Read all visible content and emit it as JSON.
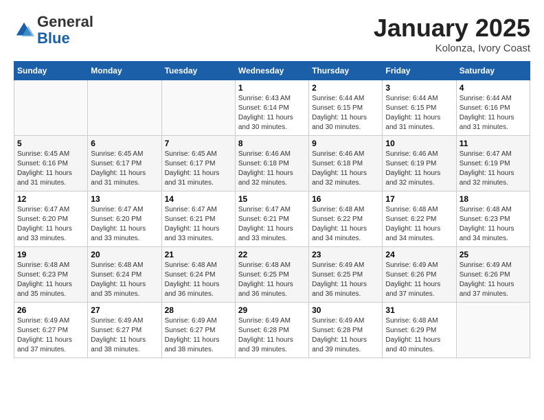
{
  "header": {
    "logo_general": "General",
    "logo_blue": "Blue",
    "month": "January 2025",
    "location": "Kolonza, Ivory Coast"
  },
  "weekdays": [
    "Sunday",
    "Monday",
    "Tuesday",
    "Wednesday",
    "Thursday",
    "Friday",
    "Saturday"
  ],
  "weeks": [
    [
      {
        "day": "",
        "info": ""
      },
      {
        "day": "",
        "info": ""
      },
      {
        "day": "",
        "info": ""
      },
      {
        "day": "1",
        "info": "Sunrise: 6:43 AM\nSunset: 6:14 PM\nDaylight: 11 hours\nand 30 minutes."
      },
      {
        "day": "2",
        "info": "Sunrise: 6:44 AM\nSunset: 6:15 PM\nDaylight: 11 hours\nand 30 minutes."
      },
      {
        "day": "3",
        "info": "Sunrise: 6:44 AM\nSunset: 6:15 PM\nDaylight: 11 hours\nand 31 minutes."
      },
      {
        "day": "4",
        "info": "Sunrise: 6:44 AM\nSunset: 6:16 PM\nDaylight: 11 hours\nand 31 minutes."
      }
    ],
    [
      {
        "day": "5",
        "info": "Sunrise: 6:45 AM\nSunset: 6:16 PM\nDaylight: 11 hours\nand 31 minutes."
      },
      {
        "day": "6",
        "info": "Sunrise: 6:45 AM\nSunset: 6:17 PM\nDaylight: 11 hours\nand 31 minutes."
      },
      {
        "day": "7",
        "info": "Sunrise: 6:45 AM\nSunset: 6:17 PM\nDaylight: 11 hours\nand 31 minutes."
      },
      {
        "day": "8",
        "info": "Sunrise: 6:46 AM\nSunset: 6:18 PM\nDaylight: 11 hours\nand 32 minutes."
      },
      {
        "day": "9",
        "info": "Sunrise: 6:46 AM\nSunset: 6:18 PM\nDaylight: 11 hours\nand 32 minutes."
      },
      {
        "day": "10",
        "info": "Sunrise: 6:46 AM\nSunset: 6:19 PM\nDaylight: 11 hours\nand 32 minutes."
      },
      {
        "day": "11",
        "info": "Sunrise: 6:47 AM\nSunset: 6:19 PM\nDaylight: 11 hours\nand 32 minutes."
      }
    ],
    [
      {
        "day": "12",
        "info": "Sunrise: 6:47 AM\nSunset: 6:20 PM\nDaylight: 11 hours\nand 33 minutes."
      },
      {
        "day": "13",
        "info": "Sunrise: 6:47 AM\nSunset: 6:20 PM\nDaylight: 11 hours\nand 33 minutes."
      },
      {
        "day": "14",
        "info": "Sunrise: 6:47 AM\nSunset: 6:21 PM\nDaylight: 11 hours\nand 33 minutes."
      },
      {
        "day": "15",
        "info": "Sunrise: 6:47 AM\nSunset: 6:21 PM\nDaylight: 11 hours\nand 33 minutes."
      },
      {
        "day": "16",
        "info": "Sunrise: 6:48 AM\nSunset: 6:22 PM\nDaylight: 11 hours\nand 34 minutes."
      },
      {
        "day": "17",
        "info": "Sunrise: 6:48 AM\nSunset: 6:22 PM\nDaylight: 11 hours\nand 34 minutes."
      },
      {
        "day": "18",
        "info": "Sunrise: 6:48 AM\nSunset: 6:23 PM\nDaylight: 11 hours\nand 34 minutes."
      }
    ],
    [
      {
        "day": "19",
        "info": "Sunrise: 6:48 AM\nSunset: 6:23 PM\nDaylight: 11 hours\nand 35 minutes."
      },
      {
        "day": "20",
        "info": "Sunrise: 6:48 AM\nSunset: 6:24 PM\nDaylight: 11 hours\nand 35 minutes."
      },
      {
        "day": "21",
        "info": "Sunrise: 6:48 AM\nSunset: 6:24 PM\nDaylight: 11 hours\nand 36 minutes."
      },
      {
        "day": "22",
        "info": "Sunrise: 6:48 AM\nSunset: 6:25 PM\nDaylight: 11 hours\nand 36 minutes."
      },
      {
        "day": "23",
        "info": "Sunrise: 6:49 AM\nSunset: 6:25 PM\nDaylight: 11 hours\nand 36 minutes."
      },
      {
        "day": "24",
        "info": "Sunrise: 6:49 AM\nSunset: 6:26 PM\nDaylight: 11 hours\nand 37 minutes."
      },
      {
        "day": "25",
        "info": "Sunrise: 6:49 AM\nSunset: 6:26 PM\nDaylight: 11 hours\nand 37 minutes."
      }
    ],
    [
      {
        "day": "26",
        "info": "Sunrise: 6:49 AM\nSunset: 6:27 PM\nDaylight: 11 hours\nand 37 minutes."
      },
      {
        "day": "27",
        "info": "Sunrise: 6:49 AM\nSunset: 6:27 PM\nDaylight: 11 hours\nand 38 minutes."
      },
      {
        "day": "28",
        "info": "Sunrise: 6:49 AM\nSunset: 6:27 PM\nDaylight: 11 hours\nand 38 minutes."
      },
      {
        "day": "29",
        "info": "Sunrise: 6:49 AM\nSunset: 6:28 PM\nDaylight: 11 hours\nand 39 minutes."
      },
      {
        "day": "30",
        "info": "Sunrise: 6:49 AM\nSunset: 6:28 PM\nDaylight: 11 hours\nand 39 minutes."
      },
      {
        "day": "31",
        "info": "Sunrise: 6:48 AM\nSunset: 6:29 PM\nDaylight: 11 hours\nand 40 minutes."
      },
      {
        "day": "",
        "info": ""
      }
    ]
  ]
}
